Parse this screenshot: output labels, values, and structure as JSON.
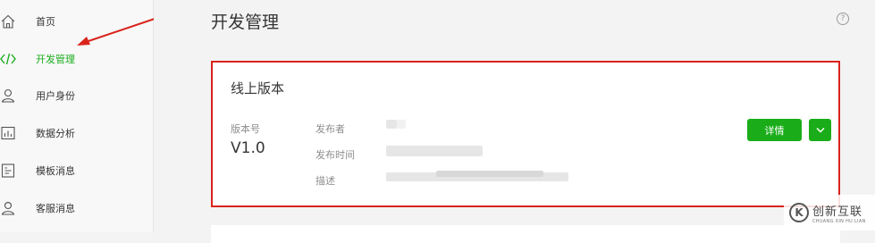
{
  "sidebar": {
    "items": [
      {
        "label": "首页",
        "icon": "home-icon"
      },
      {
        "label": "开发管理",
        "icon": "code-icon",
        "active": true
      },
      {
        "label": "用户身份",
        "icon": "user-icon"
      },
      {
        "label": "数据分析",
        "icon": "chart-icon"
      },
      {
        "label": "模板消息",
        "icon": "template-icon"
      },
      {
        "label": "客服消息",
        "icon": "support-icon"
      }
    ]
  },
  "main": {
    "title": "开发管理",
    "help_icon": "?"
  },
  "online_version": {
    "title": "线上版本",
    "version_label": "版本号",
    "version_value": "V1.0",
    "publisher_label": "发布者",
    "publish_time_label": "发布时间",
    "description_label": "描述",
    "detail_button": "详情"
  },
  "watermark": {
    "logo": "K",
    "cn": "创新互联",
    "en": "CHUANG XIN HU LIAN"
  },
  "colors": {
    "accent": "#1aad19",
    "highlight": "#d9241c"
  }
}
